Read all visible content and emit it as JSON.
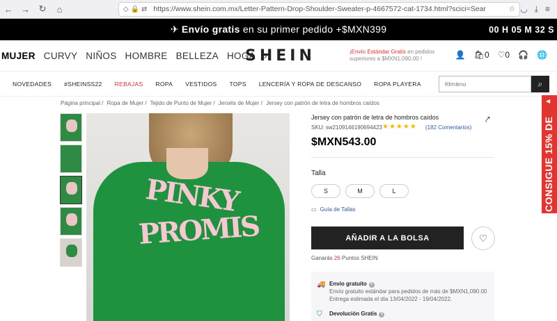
{
  "browser": {
    "url": "https://www.shein.com.mx/Letter-Pattern-Drop-Shoulder-Sweater-p-4667572-cat-1734.html?scici=Sear"
  },
  "promo": {
    "prefix": "Envío gratis",
    "rest": " en su primer pedido +$MXN399",
    "timer": "00 H 05 M 32 S"
  },
  "nav": {
    "categories": [
      "MUJER",
      "CURVY",
      "NIÑOS",
      "HOMBRE",
      "BELLEZA",
      "HOGA"
    ],
    "logo": "SHEIN",
    "ship_red": "¡Envío Estándar Gratis",
    "ship_rest": " en pedidos superiores a $MXN1,090.00 !",
    "cart_count": "0",
    "wish_count": "0"
  },
  "subnav": {
    "items": [
      "NOVEDADES",
      "#SHEINSS22",
      "REBAJAS",
      "ROPA",
      "VESTIDOS",
      "TOPS",
      "LENCERÍA Y ROPA DE DESCANSO",
      "ROPA PLAYERA"
    ],
    "search_value": "Kimono"
  },
  "breadcrumb": [
    "Página principal /",
    "Ropa de Mujer /",
    "Tejido de Punto de Mujer /",
    "Jerséis de Mujer /",
    "Jersey con patrón de letra de hombros caídos"
  ],
  "product": {
    "title": "Jersey con patrón de letra de hombros caídos",
    "sku": "SKU: sw2109146190694423",
    "rating": 4.5,
    "reviews": "(182 Comentarios)",
    "price": "$MXN543.00",
    "size_label": "Talla",
    "sizes": [
      "S",
      "M",
      "L"
    ],
    "size_guide": "Guía de Tallas",
    "add_to_bag": "AÑADIR A LA BOLSA",
    "points_prefix": "Ganarás ",
    "points_value": "26",
    "points_suffix": " Puntos SHEIN",
    "image_text_1": "PINKY",
    "image_text_2": "PROMIS"
  },
  "shipping": {
    "free_title": "Envío gratuito",
    "free_desc_1": "Envío gratuito estándar para pedidos de más de $MXN1,090.00",
    "free_desc_2": "Entrega estimada el día 13/04/2022 - 19/04/2022.",
    "return_title": "Devolución Gratis"
  },
  "side_banner": "CONSIGUE 15% DE",
  "colors": {
    "accent_red": "#e4342f",
    "sweater_green": "#1f9240",
    "star": "#f5b700"
  }
}
